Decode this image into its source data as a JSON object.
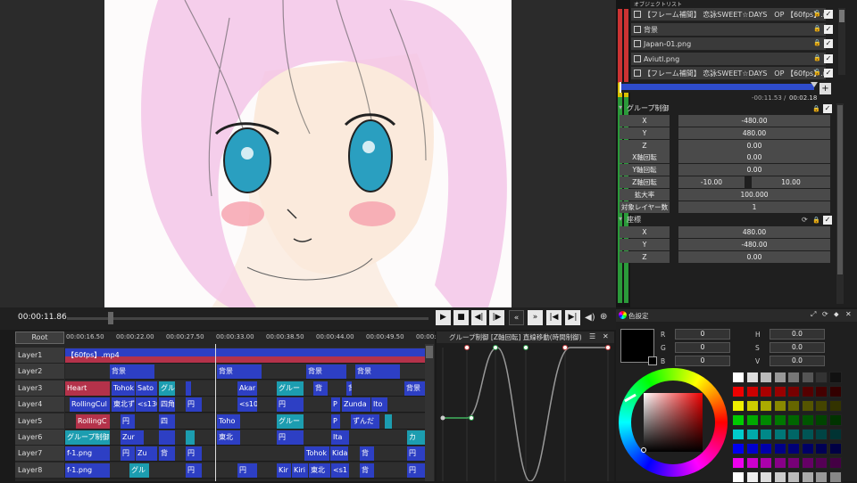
{
  "preview": {
    "timecode": "00:00:11.86",
    "controls": [
      "play",
      "stop",
      "prev-frame",
      "next-frame",
      "rewind",
      "fast-forward",
      "to-start",
      "to-end",
      "volume",
      "zoom"
    ]
  },
  "timeline": {
    "root_tab": "Root",
    "ruler_ticks": [
      "00:00:16.50",
      "00:00:22.00",
      "00:00:27.50",
      "00:00:33.00",
      "00:00:38.50",
      "00:00:44.00",
      "00:00:49.50",
      "00:00:5"
    ],
    "layers": [
      {
        "name": "Layer1",
        "clips": [
          {
            "text": "【60fps】.mp4",
            "start": 0,
            "width": 403,
            "style": "main"
          }
        ]
      },
      {
        "name": "Layer2",
        "clips": [
          {
            "text": "背景",
            "start": 50,
            "width": 50,
            "style": "b"
          },
          {
            "text": "背景",
            "start": 170,
            "width": 50,
            "style": "b"
          },
          {
            "text": "背景",
            "start": 270,
            "width": 45,
            "style": "b"
          },
          {
            "text": "背景",
            "start": 325,
            "width": 50,
            "style": "b"
          }
        ]
      },
      {
        "name": "Layer3",
        "clips": [
          {
            "text": "Heart",
            "start": 0,
            "width": 50,
            "style": "red"
          },
          {
            "text": "Tohok",
            "start": 52,
            "width": 26,
            "style": "b"
          },
          {
            "text": "Sato",
            "start": 79,
            "width": 24,
            "style": "b"
          },
          {
            "text": "グル",
            "start": 105,
            "width": 18,
            "style": "cy"
          },
          {
            "text": "",
            "start": 135,
            "width": 6,
            "style": "b"
          },
          {
            "text": "Akar",
            "start": 193,
            "width": 22,
            "style": "b"
          },
          {
            "text": "グルー",
            "start": 237,
            "width": 30,
            "style": "cy"
          },
          {
            "text": "背",
            "start": 278,
            "width": 16,
            "style": "b"
          },
          {
            "text": "背",
            "start": 315,
            "width": 6,
            "style": "b"
          },
          {
            "text": "背景",
            "start": 380,
            "width": 23,
            "style": "b"
          }
        ]
      },
      {
        "name": "Layer4",
        "clips": [
          {
            "text": "RollingCul",
            "start": 5,
            "width": 45,
            "style": "b"
          },
          {
            "text": "東北ず",
            "start": 52,
            "width": 26,
            "style": "b"
          },
          {
            "text": "<s130",
            "start": 79,
            "width": 24,
            "style": "b"
          },
          {
            "text": "四角",
            "start": 105,
            "width": 18,
            "style": "b"
          },
          {
            "text": "円",
            "start": 135,
            "width": 18,
            "style": "b"
          },
          {
            "text": "<s10",
            "start": 193,
            "width": 22,
            "style": "b"
          },
          {
            "text": "円",
            "start": 237,
            "width": 30,
            "style": "b"
          },
          {
            "text": "P",
            "start": 298,
            "width": 10,
            "style": "b"
          },
          {
            "text": "Zunda",
            "start": 310,
            "width": 32,
            "style": "b"
          },
          {
            "text": "Ito",
            "start": 343,
            "width": 18,
            "style": "b"
          }
        ]
      },
      {
        "name": "Layer5",
        "clips": [
          {
            "text": "RollingC",
            "start": 12,
            "width": 38,
            "style": "red"
          },
          {
            "text": "円",
            "start": 62,
            "width": 16,
            "style": "b"
          },
          {
            "text": "四",
            "start": 105,
            "width": 18,
            "style": "b"
          },
          {
            "text": "Toho",
            "start": 170,
            "width": 26,
            "style": "b"
          },
          {
            "text": "グルー",
            "start": 237,
            "width": 30,
            "style": "cy"
          },
          {
            "text": "P",
            "start": 298,
            "width": 10,
            "style": "b"
          },
          {
            "text": "ずんだ",
            "start": 320,
            "width": 32,
            "style": "b"
          },
          {
            "text": "",
            "start": 358,
            "width": 8,
            "style": "cy"
          }
        ]
      },
      {
        "name": "Layer6",
        "clips": [
          {
            "text": "グループ制御",
            "start": 0,
            "width": 50,
            "style": "cy"
          },
          {
            "text": "Zur",
            "start": 62,
            "width": 26,
            "style": "b"
          },
          {
            "text": "",
            "start": 105,
            "width": 18,
            "style": "b"
          },
          {
            "text": "",
            "start": 135,
            "width": 10,
            "style": "cy"
          },
          {
            "text": "東北",
            "start": 170,
            "width": 26,
            "style": "b"
          },
          {
            "text": "円",
            "start": 237,
            "width": 30,
            "style": "b"
          },
          {
            "text": "Ita",
            "start": 298,
            "width": 20,
            "style": "b"
          },
          {
            "text": "カ",
            "start": 383,
            "width": 20,
            "style": "cy"
          }
        ]
      },
      {
        "name": "Layer7",
        "clips": [
          {
            "text": "f-1.png",
            "start": 0,
            "width": 50,
            "style": "b"
          },
          {
            "text": "円",
            "start": 62,
            "width": 16,
            "style": "b"
          },
          {
            "text": "Zu",
            "start": 79,
            "width": 24,
            "style": "b"
          },
          {
            "text": "背",
            "start": 105,
            "width": 18,
            "style": "b"
          },
          {
            "text": "円",
            "start": 135,
            "width": 18,
            "style": "b"
          },
          {
            "text": "Tohok",
            "start": 268,
            "width": 28,
            "style": "b"
          },
          {
            "text": "Kida",
            "start": 297,
            "width": 20,
            "style": "b"
          },
          {
            "text": "背",
            "start": 330,
            "width": 16,
            "style": "b"
          },
          {
            "text": "円",
            "start": 383,
            "width": 20,
            "style": "b"
          }
        ]
      },
      {
        "name": "Layer8",
        "clips": [
          {
            "text": "f-1.png",
            "start": 0,
            "width": 50,
            "style": "b"
          },
          {
            "text": "グル",
            "start": 72,
            "width": 22,
            "style": "cy"
          },
          {
            "text": "円",
            "start": 135,
            "width": 18,
            "style": "b"
          },
          {
            "text": "円",
            "start": 193,
            "width": 22,
            "style": "b"
          },
          {
            "text": "Kir",
            "start": 237,
            "width": 16,
            "style": "b"
          },
          {
            "text": "Kiri",
            "start": 254,
            "width": 18,
            "style": "b"
          },
          {
            "text": "東北",
            "start": 273,
            "width": 24,
            "style": "b"
          },
          {
            "text": "<s1",
            "start": 298,
            "width": 20,
            "style": "b"
          },
          {
            "text": "背",
            "start": 330,
            "width": 16,
            "style": "b"
          },
          {
            "text": "円",
            "start": 383,
            "width": 20,
            "style": "b"
          }
        ]
      }
    ]
  },
  "graph": {
    "title": "グループ制御 [Z軸回転] 直線移動(時間制御)"
  },
  "objects": {
    "title": "オブジェクトリスト",
    "items": [
      "【フレーム補間】 恋詠SWEET☆DAYS　OP 【60fps】.mp4",
      "背景",
      "Japan-01.png",
      "Aviutl.png",
      "【フレーム補間】 恋詠SWEET☆DAYS　OP 【60fps】.mp4"
    ]
  },
  "playhead": {
    "remaining": "-00:11.53",
    "total": "00:02.18",
    "separator": "/"
  },
  "group_control": {
    "title": "グループ制御",
    "props": [
      {
        "label": "X",
        "value": "-480.00"
      },
      {
        "label": "Y",
        "value": "480.00"
      },
      {
        "label": "Z",
        "value": "0.00"
      },
      {
        "label": "X軸回転",
        "value": "0.00"
      },
      {
        "label": "Y軸回転",
        "value": "0.00"
      },
      {
        "label": "Z軸回転",
        "value_start": "-10.00",
        "value_end": "10.00"
      },
      {
        "label": "拡大率",
        "value": "100.000"
      },
      {
        "label": "対象レイヤー数",
        "value": "1"
      }
    ]
  },
  "coords": {
    "title": "座標",
    "props": [
      {
        "label": "X",
        "value": "480.00"
      },
      {
        "label": "Y",
        "value": "-480.00"
      },
      {
        "label": "Z",
        "value": "0.00"
      }
    ]
  },
  "color_panel": {
    "title": "色設定",
    "fields": [
      {
        "label": "R",
        "value": "0"
      },
      {
        "label": "G",
        "value": "0"
      },
      {
        "label": "B",
        "value": "0"
      }
    ],
    "fields2": [
      {
        "label": "H",
        "value": "0.0"
      },
      {
        "label": "S",
        "value": "0.0"
      },
      {
        "label": "V",
        "value": "0.0"
      }
    ],
    "current_color": "#000000"
  }
}
